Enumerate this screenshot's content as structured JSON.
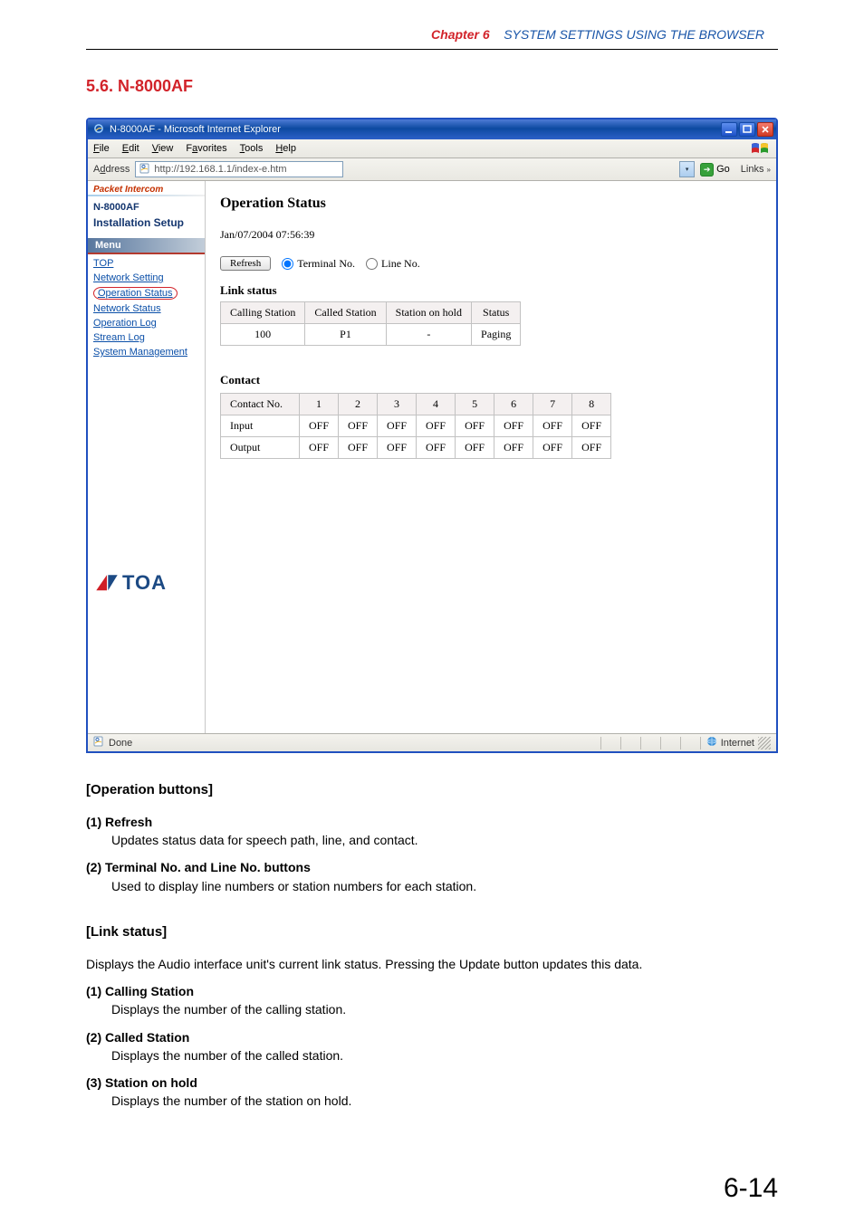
{
  "header": {
    "chapter_label": "Chapter 6",
    "chapter_title": "SYSTEM SETTINGS USING THE BROWSER",
    "section": "5.6. N-8000AF"
  },
  "ie": {
    "title": "N-8000AF - Microsoft Internet Explorer",
    "menus": [
      "File",
      "Edit",
      "View",
      "Favorites",
      "Tools",
      "Help"
    ],
    "address_label": "Address",
    "url": "http://192.168.1.1/index-e.htm",
    "go_label": "Go",
    "links_label": "Links",
    "status_done": "Done",
    "status_zone": "Internet"
  },
  "side": {
    "packet_brand": "Packet Intercom",
    "model": "N-8000AF",
    "setup": "Installation Setup",
    "menu_label": "Menu",
    "items": {
      "top": "TOP",
      "network_setting": "Network Setting",
      "operation_status": "Operation Status",
      "network_status": "Network Status",
      "operation_log": "Operation Log",
      "stream_log": "Stream Log",
      "system_management": "System Management"
    },
    "toa": "TOA"
  },
  "main": {
    "title": "Operation Status",
    "timestamp": "Jan/07/2004 07:56:39",
    "refresh": "Refresh",
    "opt_terminal": "Terminal No.",
    "opt_line": "Line No.",
    "link_status_label": "Link status",
    "link_headers": [
      "Calling Station",
      "Called Station",
      "Station on hold",
      "Status"
    ],
    "link_row": [
      "100",
      "P1",
      "-",
      "Paging"
    ],
    "contact_label": "Contact",
    "contact_headers": [
      "Contact No.",
      "1",
      "2",
      "3",
      "4",
      "5",
      "6",
      "7",
      "8"
    ],
    "contact_rows": [
      {
        "label": "Input",
        "vals": [
          "OFF",
          "OFF",
          "OFF",
          "OFF",
          "OFF",
          "OFF",
          "OFF",
          "OFF"
        ]
      },
      {
        "label": "Output",
        "vals": [
          "OFF",
          "OFF",
          "OFF",
          "OFF",
          "OFF",
          "OFF",
          "OFF",
          "OFF"
        ]
      }
    ]
  },
  "article": {
    "opbuttons_title": "[Operation buttons]",
    "opb1_t": "(1)  Refresh",
    "opb1_b": "Updates status data for speech path, line, and contact.",
    "opb2_t": "(2)  Terminal No. and Line No. buttons",
    "opb2_b": "Used to display line numbers or station numbers for each station.",
    "linkstatus_title": "[Link status]",
    "linkstatus_intro": "Displays the Audio interface unit's current link status. Pressing the Update button updates this data.",
    "ls1_t": "(1)  Calling Station",
    "ls1_b": "Displays the number of the calling station.",
    "ls2_t": "(2)  Called Station",
    "ls2_b": "Displays the number of the called station.",
    "ls3_t": "(3)  Station on hold",
    "ls3_b": "Displays the number of the station on hold."
  },
  "page_number": "6-14"
}
